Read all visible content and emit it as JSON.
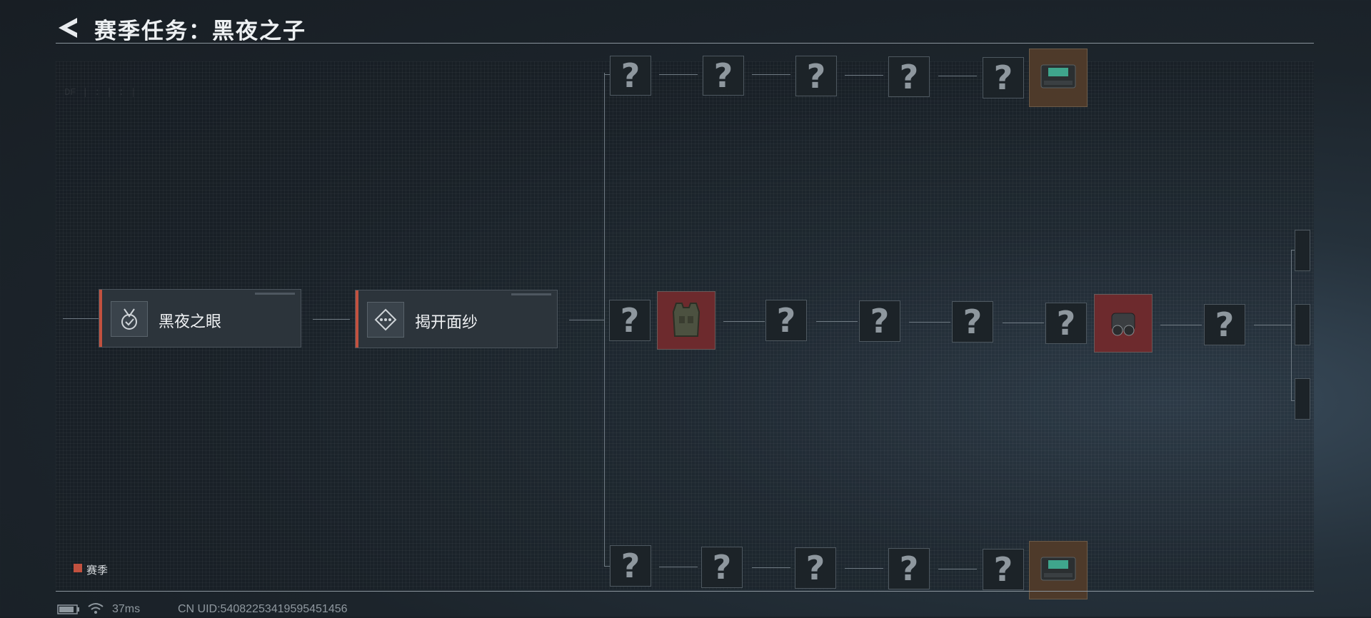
{
  "header": {
    "title": "赛季任务：黑夜之子"
  },
  "missions": [
    {
      "label": "黑夜之眼",
      "icon": "medal-check-icon"
    },
    {
      "label": "揭开面纱",
      "icon": "diamond-dots-icon"
    }
  ],
  "node_mark": "?",
  "legend": {
    "label": "赛季",
    "color": "#c2513f"
  },
  "status": {
    "ping": "37ms",
    "uid": "CN UID:540822534195954514​56"
  },
  "colors": {
    "accent": "#c2513f",
    "reward_bg": "#6d2a2d",
    "crate_bg": "#4e3a2a"
  }
}
